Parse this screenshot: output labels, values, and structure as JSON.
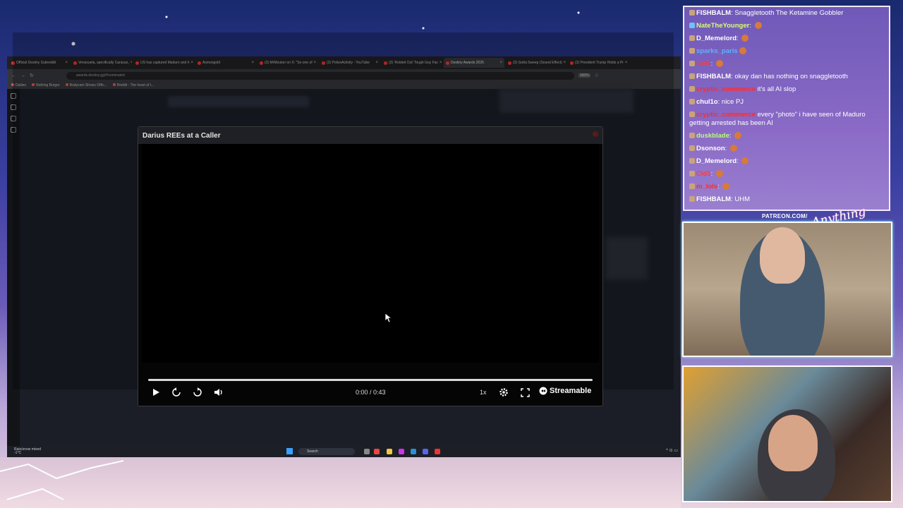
{
  "browser": {
    "tabs": [
      {
        "label": "Official Destiny Subreddit",
        "active": false
      },
      {
        "label": "Venezuela, specifically Caracas,",
        "active": false
      },
      {
        "label": "US has captured Maduro and h",
        "active": false
      },
      {
        "label": "Asmongold",
        "active": false
      },
      {
        "label": "(3) MrMouton on X: \"So one of",
        "active": false
      },
      {
        "label": "(3) PoliceActivity - YouTube",
        "active": false
      },
      {
        "label": "(3) 'Roided Out' Tough Guy Fac",
        "active": false
      },
      {
        "label": "Destiny Awards 2025",
        "active": true
      },
      {
        "label": "(3) Gotta Sweep (Sound Effect)",
        "active": false
      },
      {
        "label": "(3) President Trump Holds a Pr",
        "active": false
      }
    ],
    "url": "awards.destiny.gg/#!nominated",
    "zoom": "160%",
    "bookmarks": [
      "Dailies",
      "Nothing Burger",
      "Bodycam Shows Offic...",
      "Reddit - The heart of t..."
    ]
  },
  "modal": {
    "title": "Darius REEs at a Caller",
    "time": "0:00 / 0:43",
    "speed": "1x",
    "brand": "Streamable"
  },
  "taskbar": {
    "weather_line1": "Rain/snow mixed",
    "weather_line2": "-1°C",
    "search": "Search"
  },
  "chat": {
    "messages": [
      {
        "user": "FISHBALM",
        "sep": ": ",
        "text": "Snaggletooth The Ketamine Gobbler",
        "color": "#ffffff",
        "emote": false,
        "badge": "sub"
      },
      {
        "user": "NateTheYounger",
        "sep": ": ",
        "text": "",
        "color": "#d8ff6a",
        "emote": true,
        "badge": "sword"
      },
      {
        "user": "D_Memelord",
        "sep": ": ",
        "text": "",
        "color": "#ffffff",
        "emote": true,
        "badge": "sub"
      },
      {
        "user": "sparks_paris",
        "sep": "",
        "text": "",
        "color": "#5fb2ff",
        "emote": true,
        "badge": "sub"
      },
      {
        "user": "Cid1",
        "sep": ": ",
        "text": "",
        "color": "#ff3b3b",
        "emote": true,
        "badge": "sub"
      },
      {
        "user": "FISHBALM",
        "sep": ": ",
        "text": "okay dan has nothing on snaggletooth",
        "color": "#ffffff",
        "emote": false,
        "badge": "sub"
      },
      {
        "user": "cryptic_commerce",
        "sep": " ",
        "text": "it's all AI slop",
        "color": "#ff2a2a",
        "emote": false,
        "badge": "sub"
      },
      {
        "user": "chul1o",
        "sep": ": ",
        "text": "nice PJ",
        "color": "#ffffff",
        "emote": false,
        "badge": "sub"
      },
      {
        "user": "cryptic_commerce",
        "sep": " ",
        "text": "every \"photo\" i have seen of Maduro getting arrested has been AI",
        "color": "#ff2a2a",
        "emote": false,
        "badge": "sub"
      },
      {
        "user": "duskblade",
        "sep": ": ",
        "text": "",
        "color": "#b8ff7a",
        "emote": true,
        "badge": "sub"
      },
      {
        "user": "Dsonson",
        "sep": ": ",
        "text": "",
        "color": "#ffffff",
        "emote": true,
        "badge": "sub"
      },
      {
        "user": "D_Memelord",
        "sep": ": ",
        "text": "",
        "color": "#ffffff",
        "emote": true,
        "badge": "sub"
      },
      {
        "user": "Cid1",
        "sep": ": ",
        "text": "",
        "color": "#ff3b3b",
        "emote": true,
        "badge": "sub"
      },
      {
        "user": "m_lols",
        "sep": ": ",
        "text": "",
        "color": "#ff2a2a",
        "emote": true,
        "badge": "sub"
      },
      {
        "user": "FISHBALM",
        "sep": ": ",
        "text": "UHM",
        "color": "#ffffff",
        "emote": false,
        "badge": "sub"
      }
    ]
  },
  "overlay": {
    "patreon": "PATREON.COM/"
  }
}
